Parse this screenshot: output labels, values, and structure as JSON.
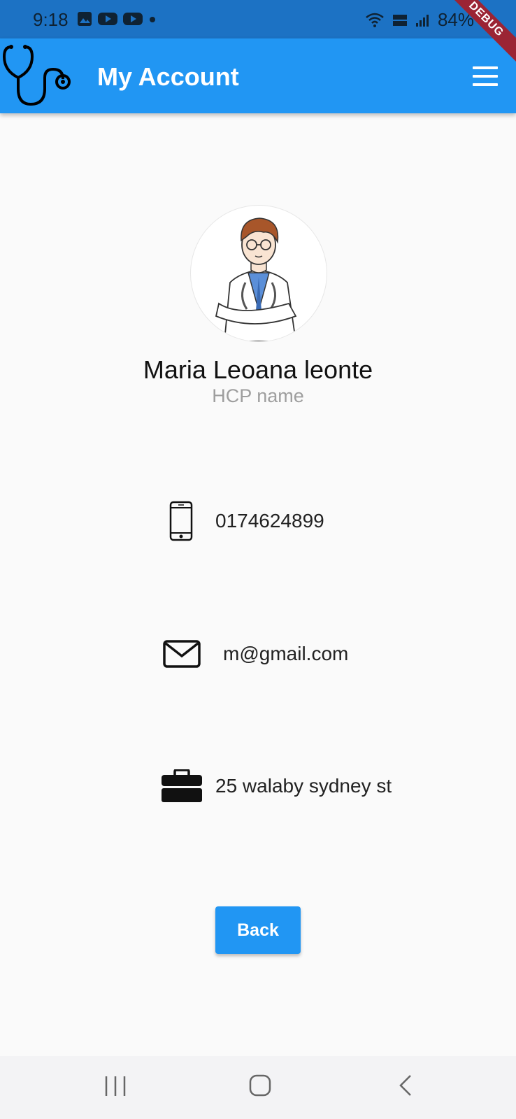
{
  "status_bar": {
    "time": "9:18",
    "battery": "84%"
  },
  "app_bar": {
    "title": "My Account",
    "debug_label": "DEBUG"
  },
  "profile": {
    "name": "Maria Leoana leonte",
    "role": "HCP name"
  },
  "contact": {
    "phone": "0174624899",
    "email": "m@gmail.com",
    "address": "25 walaby sydney st"
  },
  "actions": {
    "back_label": "Back"
  },
  "colors": {
    "primary": "#2196f3",
    "status_bar": "#1c72c4",
    "background": "#fafafa"
  },
  "icons": {
    "logo": "stethoscope-icon",
    "menu": "hamburger-menu-icon",
    "phone": "phone-icon",
    "email": "mail-icon",
    "address": "briefcase-icon"
  }
}
